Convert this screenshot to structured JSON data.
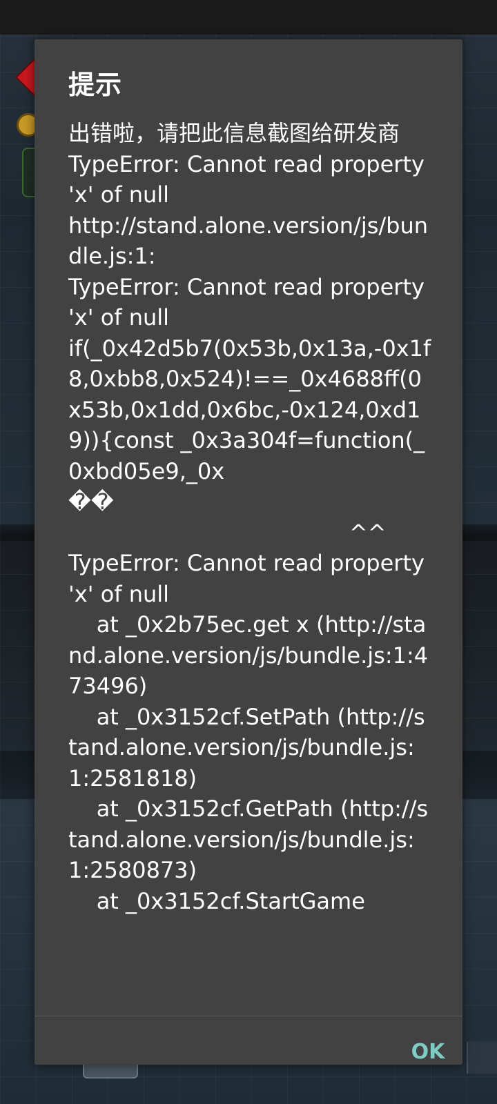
{
  "dialog": {
    "title": "提示",
    "message": "出错啦，请把此信息截图给研发商\nTypeError: Cannot read property 'x' of null\nhttp://stand.alone.version/js/bundle.js:1:\nTypeError: Cannot read property 'x' of null\nif(_0x42d5b7(0x53b,0x13a,-0x1f8,0xbb8,0x524)!==_0x4688ff(0x53b,0x1dd,0x6bc,-0x124,0xd19)){const _0x3a304f=function(_0xbd05e9,_0x\n��\n                                        ^^\nTypeError: Cannot read property 'x' of null\n    at _0x2b75ec.get x (http://stand.alone.version/js/bundle.js:1:473496)\n    at _0x3152cf.SetPath (http://stand.alone.version/js/bundle.js:1:2581818)\n    at _0x3152cf.GetPath (http://stand.alone.version/js/bundle.js:1:2580873)\n    at _0x3152cf.StartGame",
    "ok_label": "OK"
  },
  "colors": {
    "dialog_background": "#424242",
    "text": "#ffffff",
    "accent": "#80cbc4"
  }
}
